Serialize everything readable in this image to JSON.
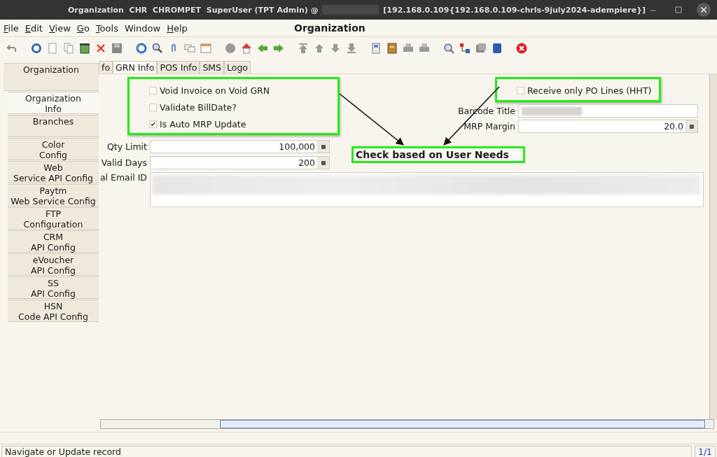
{
  "window": {
    "title": "Organization  CHR  CHROMPET  SuperUser (TPT Admin) @",
    "connection": "[192.168.0.109{192.168.0.109-chrls-9july2024-adempiere}]"
  },
  "menu": [
    {
      "label": "File",
      "mnemonic": true
    },
    {
      "label": "Edit",
      "mnemonic": true
    },
    {
      "label": "View",
      "mnemonic": true
    },
    {
      "label": "Go",
      "mnemonic": true
    },
    {
      "label": "Tools",
      "mnemonic": true
    },
    {
      "label": "Window",
      "mnemonic": false
    },
    {
      "label": "Help",
      "mnemonic": true
    }
  ],
  "form_title": "Organization",
  "side_tabs": [
    {
      "label": "Organization",
      "selected": false
    },
    {
      "label": "Organization\nInfo",
      "selected": true
    },
    {
      "label": "Branches",
      "selected": false
    },
    {
      "label": "Color\nConfig",
      "selected": false
    },
    {
      "label": "Web\nService API Config",
      "selected": false
    },
    {
      "label": "Paytm\nWeb Service Config",
      "selected": false
    },
    {
      "label": "FTP\nConfiguration",
      "selected": false
    },
    {
      "label": "CRM\nAPI Config",
      "selected": false
    },
    {
      "label": "eVoucher\nAPI Config",
      "selected": false
    },
    {
      "label": "SS\nAPI Config",
      "selected": false
    },
    {
      "label": "HSN\nCode API Config",
      "selected": false
    }
  ],
  "tabs": [
    {
      "label": "fo",
      "selected": false
    },
    {
      "label": "GRN Info",
      "selected": true
    },
    {
      "label": "POS Info",
      "selected": false
    },
    {
      "label": "SMS",
      "selected": false
    },
    {
      "label": "Logo",
      "selected": false
    }
  ],
  "left_checkboxes": [
    {
      "label": "Void Invoice on Void GRN",
      "checked": false
    },
    {
      "label": "Validate BillDate?",
      "checked": false
    },
    {
      "label": "Is Auto MRP Update",
      "checked": true
    }
  ],
  "right_checkbox": {
    "label": "Receive only PO Lines (HHT)",
    "checked": false
  },
  "right_fields": [
    {
      "label": "Barcode Title",
      "kind": "text"
    },
    {
      "label": "MRP Margin",
      "kind": "number",
      "value": "20.0"
    }
  ],
  "fields": [
    {
      "label": "Qty Limit",
      "kind": "number",
      "value": "100,000"
    },
    {
      "label": "Valid Days",
      "kind": "number",
      "value": "200"
    },
    {
      "label": "al Email ID",
      "kind": "memo"
    }
  ],
  "annotation": {
    "label": "Check based on User Needs"
  },
  "status_bar": {
    "message": "Navigate or Update record",
    "record": "1/1"
  }
}
